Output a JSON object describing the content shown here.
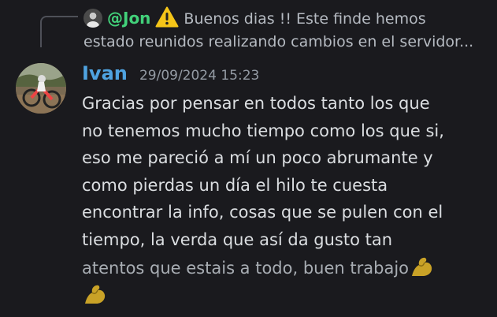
{
  "reply": {
    "author": "@Jon",
    "text_line1": "Buenos dias !!  Este finde hemos",
    "text_line2": "estado reunidos realizando cambios en el servidor..."
  },
  "message": {
    "author": "Ivan",
    "timestamp": "29/09/2024 15:23",
    "lines": [
      "Gracias por pensar en todos tanto los que",
      "no tenemos mucho tiempo como los que si,",
      "eso me pareció a mí un poco abrumante y",
      "como pierdas un día el hilo te cuesta",
      "encontrar la info, cosas que se pulen con el",
      "tiempo, la verda que así da gusto tan",
      "atentos que estais a todo, buen trabajo"
    ]
  },
  "icons": {
    "warning": "warning-icon",
    "flex": "flexed-biceps-emoji"
  },
  "colors": {
    "background": "#1a1a1e",
    "reply_author": "#42d17a",
    "author": "#4fa3e0",
    "text": "#dbdee1",
    "muted": "#949ba4"
  }
}
